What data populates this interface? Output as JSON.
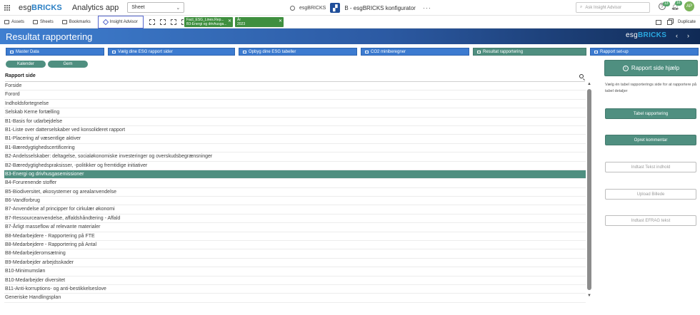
{
  "topbar": {
    "logo_pre": "esg",
    "logo_strong": "BRICKS",
    "app_title": "Analytics app",
    "sheet_label": "Sheet",
    "user_name": "esgBRICKS",
    "konfigurator": "B - esgBRICKS konfigurator",
    "ask_placeholder": "Ask Insight Advisor",
    "help_badge": "13",
    "notif_badge": "16",
    "avatar_initials": "AP"
  },
  "toolbar": {
    "assets": "Assets",
    "sheets": "Sheets",
    "bookmarks": "Bookmarks",
    "insight": "Insight Advisor",
    "filter1_title": "Fact_ESG_Lines.Rep...",
    "filter1_value": "B3-Energi og drivhusga...",
    "filter2_title": "År",
    "filter2_value": "2023",
    "duplicate": "Duplicate"
  },
  "band": {
    "title": "Resultat rapportering",
    "logo_pre": "esg",
    "logo_strong": "BRICKS"
  },
  "nav_tabs": [
    "Master Data",
    "Vælg dine ESG rapport sider",
    "Opbyg dine ESG tabeller",
    "CO2 miniberegner",
    "Resultat rapportering",
    "Rapport set-up"
  ],
  "pills": {
    "calendar": "Kalender",
    "save": "Gem"
  },
  "list": {
    "header": "Rapport side",
    "items": [
      "Forside",
      "Forord",
      "Indholdsfortegnelse",
      "Selskab Kerne fortælling",
      "B1-Basis for udarbejdelse",
      "B1-Liste over datterselskaber ved konsolideret rapport",
      "B1-Placering af væsentlige aktiver",
      "B1-Bæredygtighedscertificering",
      "B2-Andelsselskaber: deltagelse, socialøkonomiske investeringer og overskudsbegrænsninger",
      "B2-Bæredygtighedspraksisser, -politikker og fremtidige initiativer",
      "B3-Energi og drivhusgasemissioner",
      "B4-Forurenende stoffer",
      "B5-Biodiversitet, økosystemer og arealanvendelse",
      "B6-Vandforbrug",
      "B7-Anvendelse af principper for cirkulær økonomi",
      "B7-Ressourceanvendelse, affaldshåndtering - Affald",
      "B7-Årligt masseflow af relevante materialer",
      "B8-Medarbejdere - Rapportering på FTE",
      "B8-Medarbejdere - Rapportering på Antal",
      "B8-Medarbejderomsætning",
      "B9-Medarbejder arbejdsskader",
      "B10-Minimumsløn",
      "B10-Medarbejder diversitet",
      "B11-Anti-korruptions- og anti-bestikkelseslove",
      "Generiske Handlingsplan"
    ],
    "selected": "B3-Energi og drivhusgasemissioner"
  },
  "right_panel": {
    "help_button": "Rapport side hjælp",
    "help_text": "Vælg én tabel rapporterings side for at rapportere på tabel detaljer",
    "buttons": [
      "Tabel rapportering",
      "Opret kommentar",
      "Indtast Tekst indhold",
      "Upload Billede",
      "Indtast EFRAG tekst"
    ]
  },
  "colors": {
    "accent_green": "#4f8f80",
    "accent_blue": "#3c7bd0",
    "filter_green": "#3f8f3f"
  }
}
